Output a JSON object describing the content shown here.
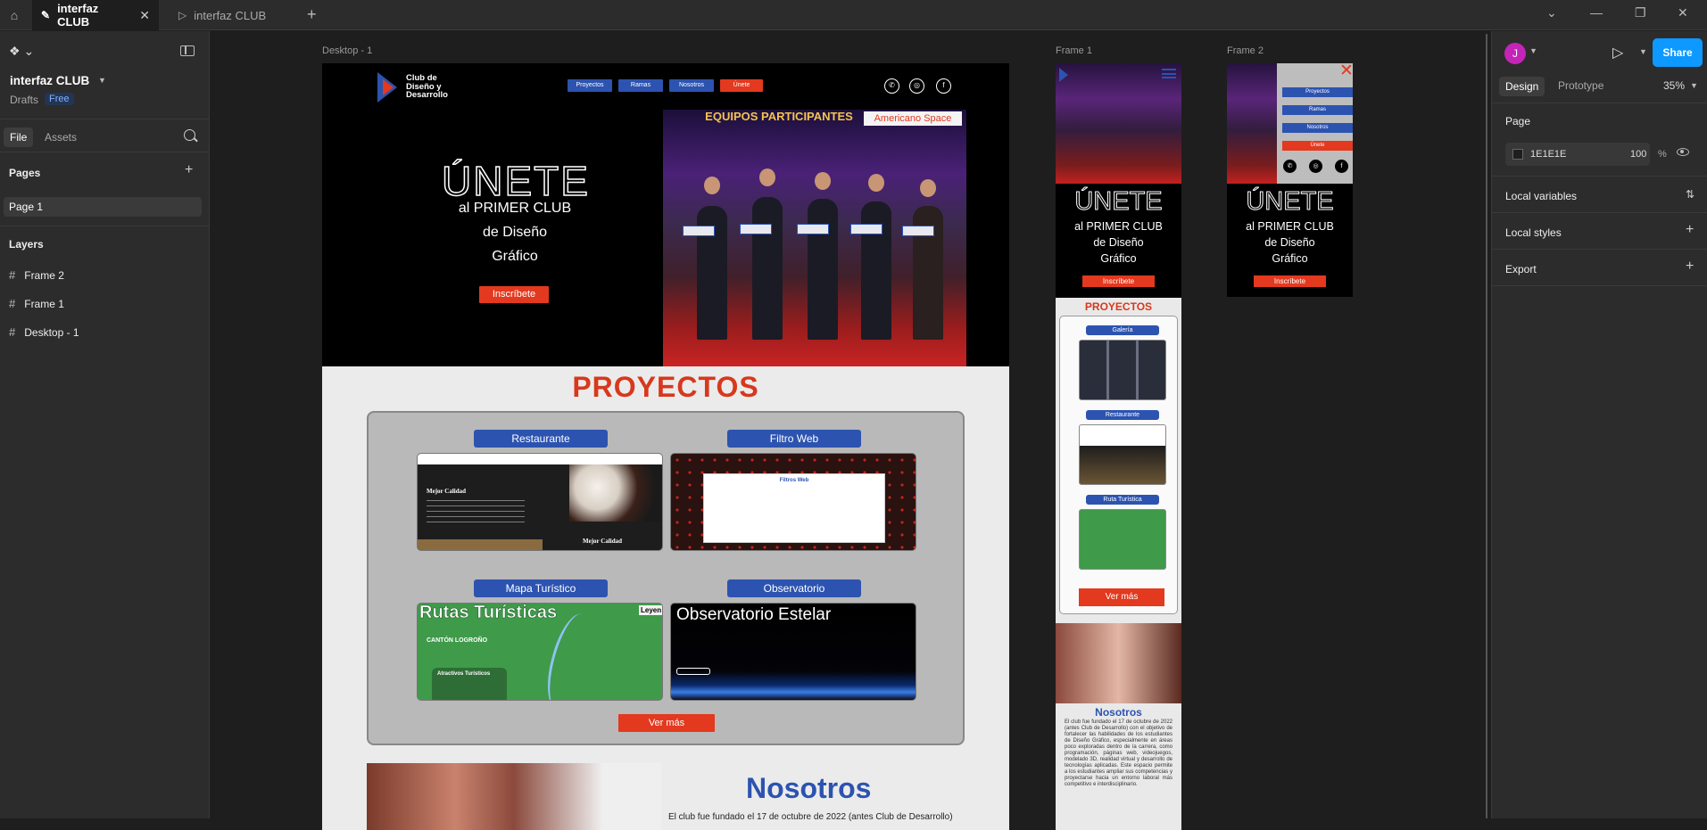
{
  "tabs": [
    {
      "label": "interfaz CLUB",
      "active": true
    },
    {
      "label": "interfaz CLUB",
      "active": false
    }
  ],
  "left_panel": {
    "file_title": "interfaz CLUB",
    "drafts": "Drafts",
    "plan_badge": "Free",
    "file_tab": "File",
    "assets_tab": "Assets",
    "pages_heading": "Pages",
    "pages": [
      "Page 1"
    ],
    "layers_heading": "Layers",
    "layers": [
      "Frame 2",
      "Frame 1",
      "Desktop - 1"
    ]
  },
  "canvas": {
    "frame_labels": {
      "desktop": "Desktop - 1",
      "frame1": "Frame 1",
      "frame2": "Frame 2"
    },
    "hero": {
      "logo_text": "Club de Diseño y Desarrollo",
      "nav": [
        "Proyectos",
        "Ramas",
        "Nosotros",
        "Únete"
      ],
      "social_icons": [
        "whatsapp-icon",
        "instagram-icon",
        "facebook-icon"
      ],
      "headline": "ÚNETE",
      "line1": "al PRIMER CLUB",
      "line2": "de Diseño",
      "line3": "Gráfico",
      "cta": "Inscríbete",
      "image_caption_title": "EQUIPOS PARTICIPANTES",
      "image_caption_tag": "Americano Space"
    },
    "projects": {
      "title": "PROYECTOS",
      "items": [
        {
          "label": "Restaurante",
          "thumb_heading": "Mejor Calidad",
          "thumb_heading2": "Mejor Calidad"
        },
        {
          "label": "Filtro Web",
          "thumb_heading": "Filtros Web"
        },
        {
          "label": "Mapa Turístico",
          "thumb_heading": "Rutas Turísticas",
          "thumb_sub": "CANTÓN LOGROÑO",
          "thumb_attr": "Atractivos Turísticos",
          "thumb_legend": "Leyen"
        },
        {
          "label": "Observatorio",
          "thumb_heading": "Observatorio Estelar"
        }
      ],
      "more_button": "Ver más"
    },
    "about": {
      "title": "Nosotros",
      "text": "El club fue fundado el 17 de octubre de 2022 (antes Club de Desarrollo)"
    },
    "frame1": {
      "headline": "ÚNETE",
      "line1": "al PRIMER CLUB",
      "line2": "de Diseño",
      "line3": "Gráfico",
      "cta": "Inscríbete",
      "projects_title": "PROYECTOS",
      "labels": [
        "Galería",
        "Restaurante",
        "Ruta Turística"
      ],
      "more_button": "Ver más",
      "about_title": "Nosotros",
      "about_text": "El club fue fundado el 17 de octubre de 2022 (antes Club de Desarrollo) con el objetivo de fortalecer las habilidades de los estudiantes de Diseño Gráfico, especialmente en áreas poco exploradas dentro de la carrera, como programación, páginas web, videojuegos, modelado 3D, realidad virtual y desarrollo de tecnologías aplicadas. Este espacio permite a los estudiantes ampliar sus competencias y proyectarse hacia un entorno laboral más competitivo e interdisciplinario."
    },
    "frame2": {
      "menu": [
        "Proyectos",
        "Ramas",
        "Nosotros",
        "Únete"
      ],
      "headline": "ÚNETE",
      "line1": "al PRIMER CLUB",
      "line2": "de Diseño",
      "line3": "Gráfico",
      "cta": "Inscríbete"
    }
  },
  "right_panel": {
    "avatar_initial": "J",
    "share": "Share",
    "design_tab": "Design",
    "prototype_tab": "Prototype",
    "zoom": "35%",
    "page_heading": "Page",
    "bg_hex": "1E1E1E",
    "bg_opacity": "100",
    "pct": "%",
    "local_variables": "Local variables",
    "local_styles": "Local styles",
    "export": "Export"
  },
  "colors": {
    "accent_blue": "#2c53b0",
    "accent_red": "#e3391f",
    "share_blue": "#0d99ff"
  }
}
